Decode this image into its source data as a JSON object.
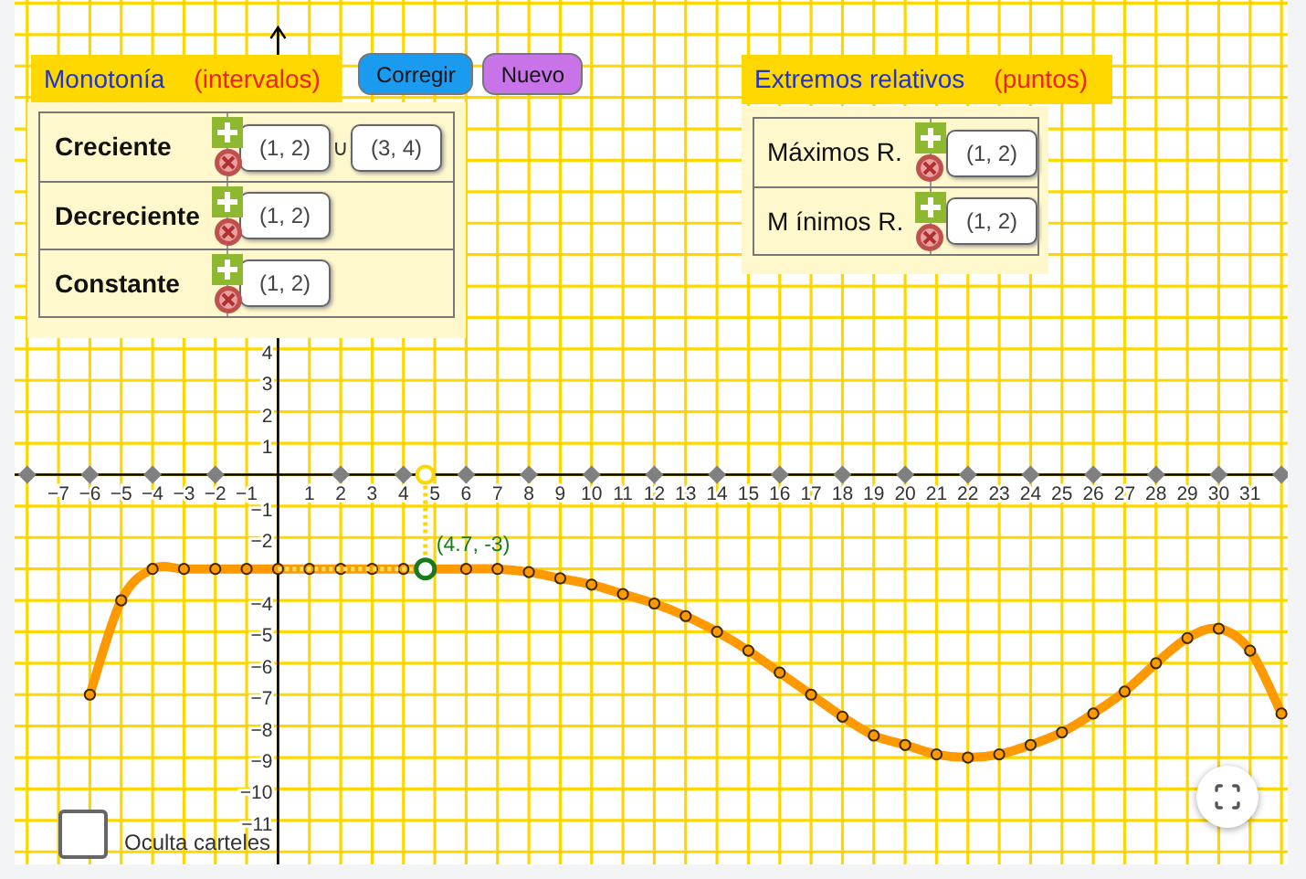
{
  "monotonia": {
    "title": "Monotonía",
    "subtitle": "(intervalos)",
    "rows": [
      {
        "label": "Creciente",
        "fields": [
          "(1, 2)",
          "(3, 4)"
        ],
        "joiner": "∪"
      },
      {
        "label": "Decreciente",
        "fields": [
          "(1, 2)"
        ]
      },
      {
        "label": "Constante",
        "fields": [
          "(1, 2)"
        ]
      }
    ]
  },
  "buttons": [
    {
      "label": "Corregir",
      "color": "#1a9bf0"
    },
    {
      "label": "Nuevo",
      "color": "#c873e8"
    }
  ],
  "extremos": {
    "title": "Extremos relativos",
    "subtitle": "(puntos)",
    "rows": [
      {
        "label": "Máximos R.",
        "fields": [
          "(1, 2)"
        ]
      },
      {
        "label": "M ínimos R.",
        "fields": [
          "(1, 2)"
        ]
      }
    ]
  },
  "checkbox": {
    "label": "Oculta carteles",
    "checked": false
  },
  "graph": {
    "chart_data": {
      "type": "line",
      "grid": true,
      "xlim": [
        -8.4,
        32.2
      ],
      "ylim": [
        -12.4,
        15.1
      ],
      "xticks": [
        {
          "value": -7,
          "label": "−7"
        },
        {
          "value": -6,
          "label": "−6"
        },
        {
          "value": -5,
          "label": "−5"
        },
        {
          "value": -4,
          "label": "−4"
        },
        {
          "value": -3,
          "label": "−3"
        },
        {
          "value": -2,
          "label": "−2"
        },
        {
          "value": -1,
          "label": "−1"
        },
        1,
        2,
        3,
        4,
        5,
        6,
        7,
        8,
        9,
        10,
        11,
        12,
        13,
        14,
        15,
        16,
        17,
        18,
        19,
        20,
        21,
        22,
        23,
        24,
        25,
        26,
        27,
        28,
        29,
        30,
        31
      ],
      "yticks": [
        4,
        3,
        2,
        1,
        {
          "value": -1,
          "label": "−1"
        },
        {
          "value": -2,
          "label": "−2"
        },
        {
          "value": -4,
          "label": "−4"
        },
        {
          "value": -5,
          "label": "−5"
        },
        {
          "value": -6,
          "label": "−6"
        },
        {
          "value": -7,
          "label": "−7"
        },
        {
          "value": -8,
          "label": "−8"
        },
        {
          "value": -9,
          "label": "−9"
        },
        {
          "value": -10,
          "label": "−10"
        },
        {
          "value": -11,
          "label": "−11"
        }
      ],
      "x": [
        -6,
        -5,
        -4,
        -3,
        -2,
        -1,
        0,
        1,
        2,
        3,
        4,
        5,
        6,
        7,
        8,
        9,
        10,
        11,
        12,
        13,
        14,
        15,
        16,
        17,
        18,
        19,
        20,
        21,
        22,
        23,
        24,
        25,
        26,
        27,
        28,
        29,
        30,
        31,
        32
      ],
      "series": [
        {
          "color": "#ff9900",
          "marker": "circle",
          "values": [
            -7,
            -4,
            -3,
            -3,
            -3,
            -3,
            -3,
            -3,
            -3,
            -3,
            -3,
            -3,
            -3,
            -3,
            -3.1,
            -3.3,
            -3.5,
            -3.8,
            -4.1,
            -4.5,
            -5.0,
            -5.6,
            -6.3,
            -7.0,
            -7.7,
            -8.3,
            -8.6,
            -8.9,
            -9,
            -8.9,
            -8.6,
            -8.2,
            -7.6,
            -6.9,
            -6.0,
            -5.2,
            -4.9,
            -5.6,
            -7.6
          ]
        }
      ],
      "annotations": [
        {
          "x": 4.7,
          "y": -3,
          "text": "(4.7, -3)"
        }
      ]
    }
  }
}
